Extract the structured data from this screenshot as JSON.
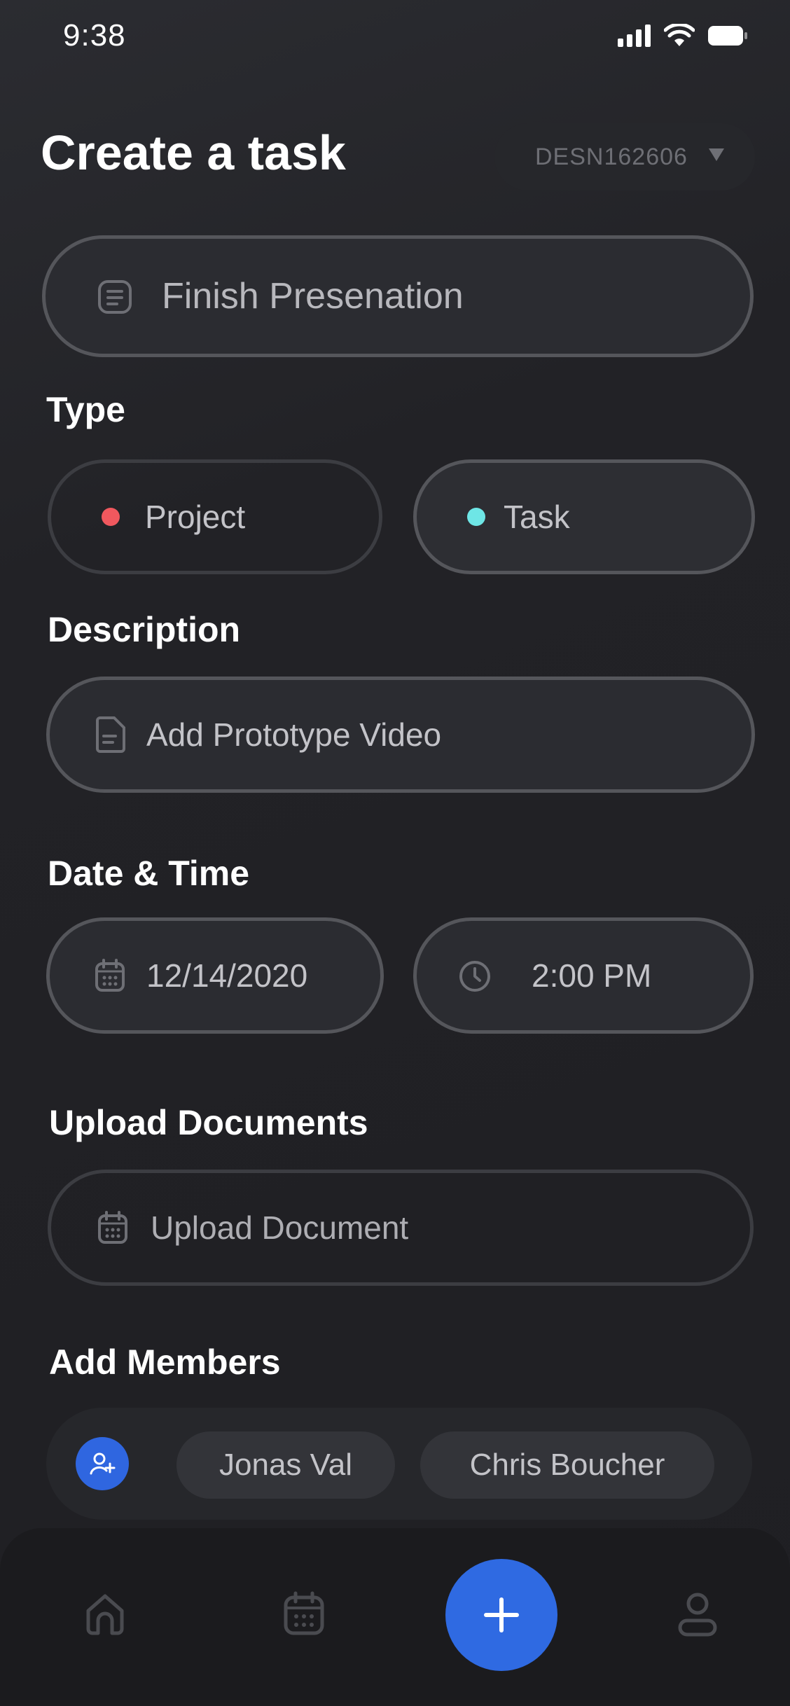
{
  "status_bar": {
    "time": "9:38"
  },
  "header": {
    "title": "Create a task",
    "project_code": "DESN162606"
  },
  "task_name": {
    "value": "Finish Presenation"
  },
  "type_section": {
    "label": "Type",
    "options": [
      {
        "label": "Project",
        "dot_color": "#f0585e"
      },
      {
        "label": "Task",
        "dot_color": "#6ee6e6"
      }
    ]
  },
  "description_section": {
    "label": "Description",
    "value": "Add Prototype Video"
  },
  "datetime_section": {
    "label": "Date & Time",
    "date": "12/14/2020",
    "time": "2:00 PM"
  },
  "upload_section": {
    "label": "Upload Documents",
    "placeholder": "Upload Document"
  },
  "members_section": {
    "label": "Add Members",
    "members": [
      "Jonas Val",
      "Chris Boucher"
    ]
  },
  "bottom_nav": {
    "items": [
      "home-icon",
      "calendar-icon",
      "plus-icon",
      "profile-icon"
    ],
    "fab_color": "#2f6ae2"
  }
}
